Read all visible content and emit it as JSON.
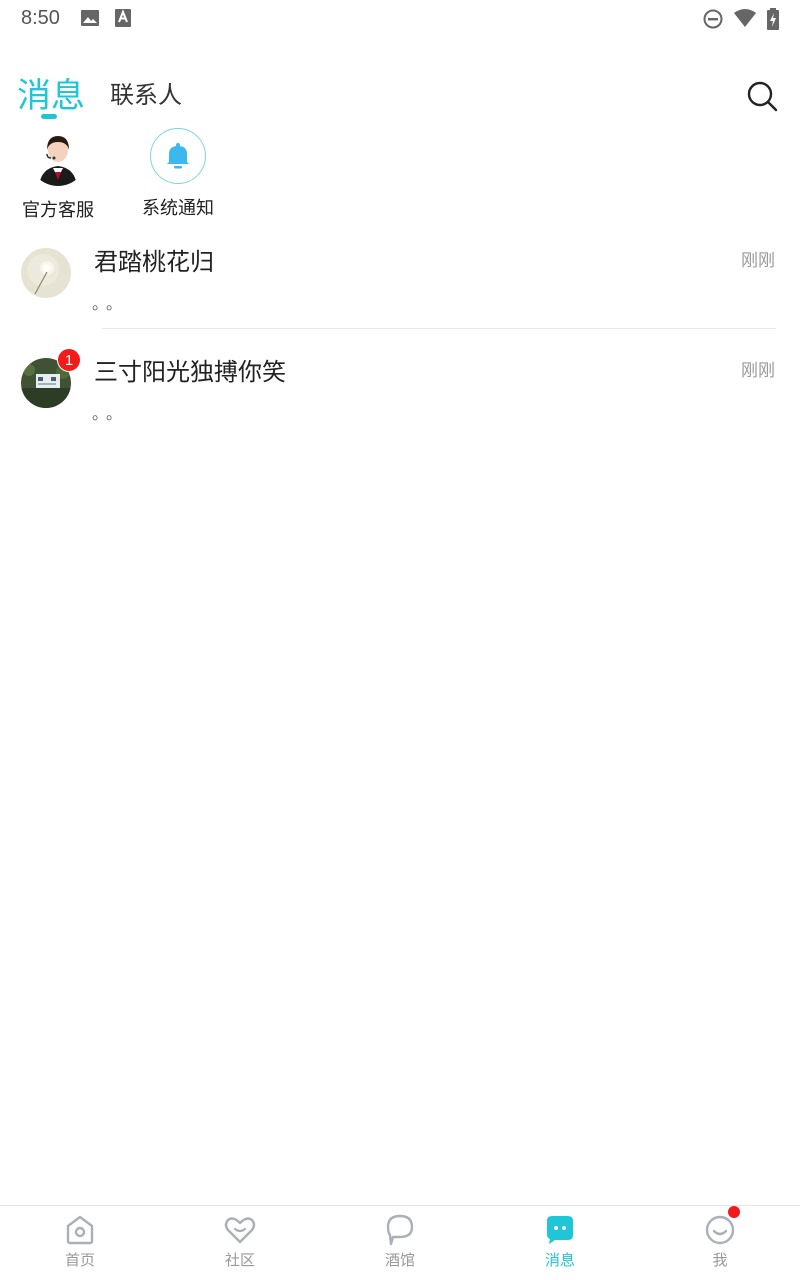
{
  "status_bar": {
    "time": "8:50",
    "icons_left": [
      "image-icon",
      "text-icon"
    ],
    "icons_right": [
      "dnd-icon",
      "wifi-icon",
      "battery-charging-icon"
    ]
  },
  "header": {
    "tabs": [
      {
        "label": "消息",
        "active": true
      },
      {
        "label": "联系人",
        "active": false
      }
    ],
    "search_icon": "search-icon"
  },
  "quick_entries": [
    {
      "label": "官方客服",
      "icon": "service-avatar"
    },
    {
      "label": "系统通知",
      "icon": "bell-icon"
    }
  ],
  "chats": [
    {
      "name": "君踏桃花归",
      "time": "刚刚",
      "preview": "。。",
      "badge": null
    },
    {
      "name": "三寸阳光独搏你笑",
      "time": "刚刚",
      "preview": "。。",
      "badge": "1"
    }
  ],
  "bottom_nav": [
    {
      "label": "首页",
      "icon": "home-icon",
      "active": false
    },
    {
      "label": "社区",
      "icon": "heart-icon",
      "active": false
    },
    {
      "label": "酒馆",
      "icon": "tavern-icon",
      "active": false
    },
    {
      "label": "消息",
      "icon": "message-icon",
      "active": true
    },
    {
      "label": "我",
      "icon": "profile-icon",
      "active": false,
      "dot": true
    }
  ],
  "colors": {
    "accent": "#1fc6d8",
    "badge": "#f21a1a",
    "inactive_nav": "#999999"
  }
}
